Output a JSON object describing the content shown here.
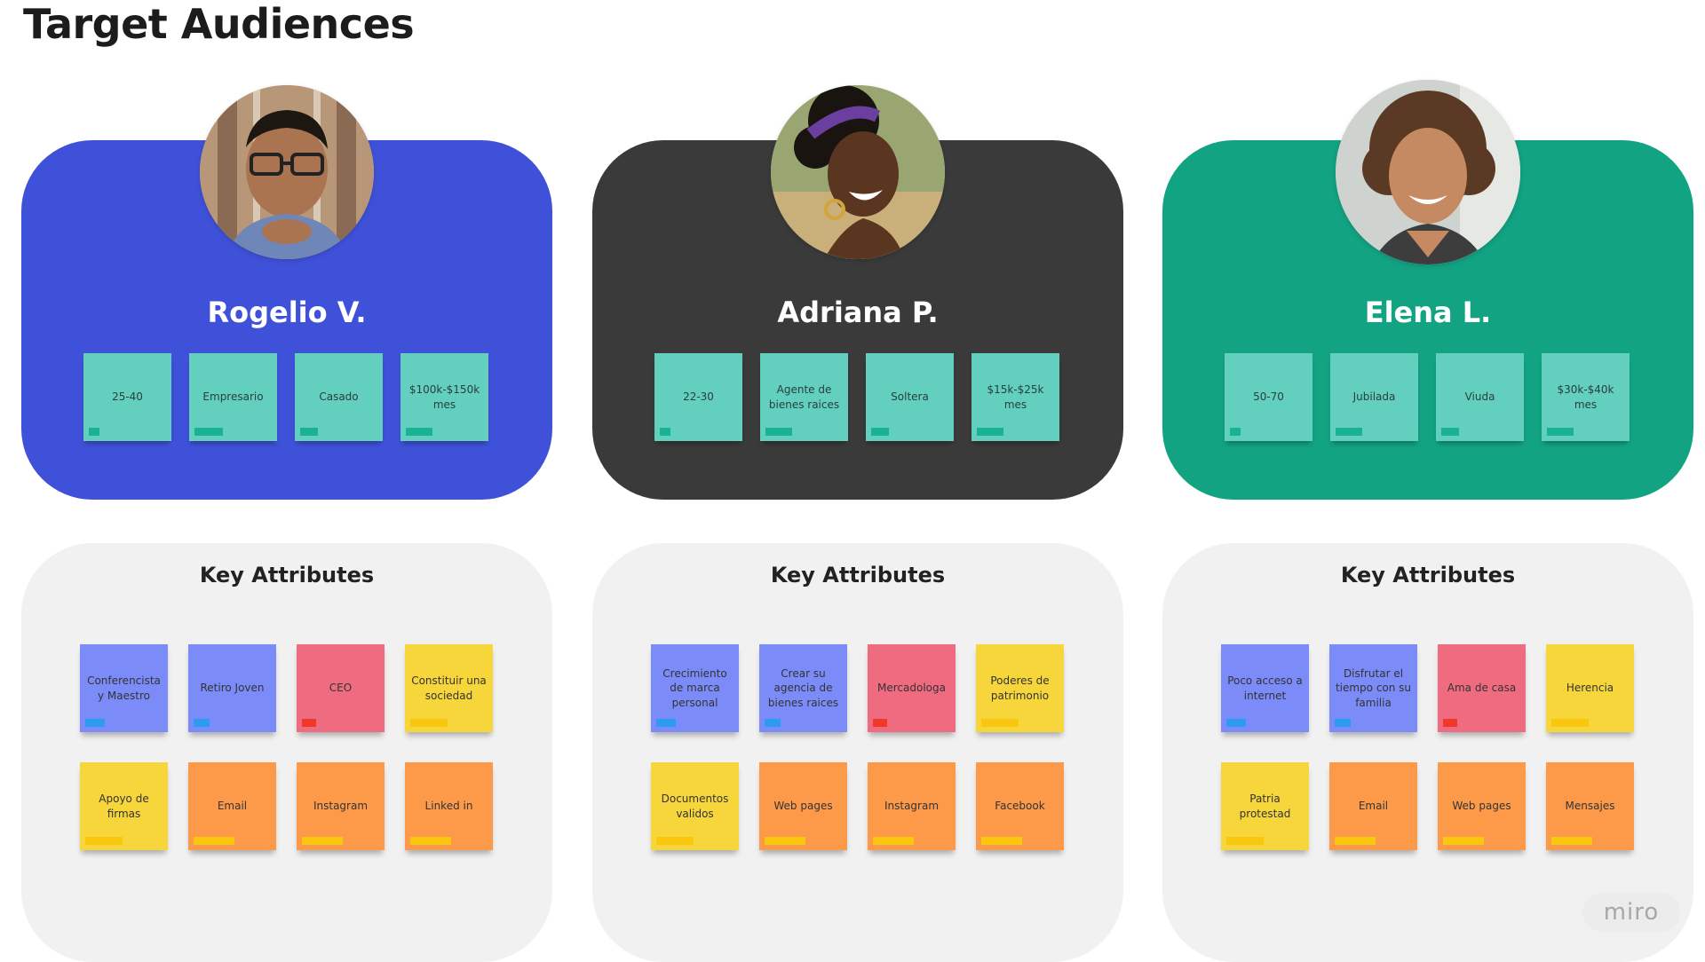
{
  "title": "Target Audiences",
  "attributes_heading": "Key Attributes",
  "personas": [
    {
      "name": "Rogelio V.",
      "card_color": "#3f51d8",
      "avatar_icon": "man-portrait",
      "demographics": [
        "25-40",
        "Empresario",
        "Casado",
        "$100k-$150k mes"
      ],
      "attributes": [
        {
          "label": "Conferencista y Maestro",
          "color": "blue"
        },
        {
          "label": "Retiro Joven",
          "color": "blue"
        },
        {
          "label": "CEO",
          "color": "red"
        },
        {
          "label": "Constituir una sociedad",
          "color": "yellow"
        },
        {
          "label": "Apoyo de firmas",
          "color": "yellow"
        },
        {
          "label": "Email",
          "color": "orange"
        },
        {
          "label": "Instagram",
          "color": "orange"
        },
        {
          "label": "Linked in",
          "color": "orange"
        }
      ]
    },
    {
      "name": "Adriana P.",
      "card_color": "#3a3a3a",
      "avatar_icon": "woman-portrait",
      "demographics": [
        "22-30",
        "Agente de bienes raices",
        "Soltera",
        "$15k-$25k mes"
      ],
      "attributes": [
        {
          "label": "Crecimiento de marca personal",
          "color": "blue"
        },
        {
          "label": "Crear su agencia de bienes raices",
          "color": "blue"
        },
        {
          "label": "Mercadologa",
          "color": "red"
        },
        {
          "label": "Poderes de patrimonio",
          "color": "yellow"
        },
        {
          "label": "Documentos validos",
          "color": "yellow"
        },
        {
          "label": "Web pages",
          "color": "orange"
        },
        {
          "label": "Instagram",
          "color": "orange"
        },
        {
          "label": "Facebook",
          "color": "orange"
        }
      ]
    },
    {
      "name": "Elena L.",
      "card_color": "#12a383",
      "avatar_icon": "woman-portrait",
      "demographics": [
        "50-70",
        "Jubilada",
        "Viuda",
        "$30k-$40k mes"
      ],
      "attributes": [
        {
          "label": "Poco acceso a internet",
          "color": "blue"
        },
        {
          "label": "Disfrutar el tiempo con su familia",
          "color": "blue"
        },
        {
          "label": "Ama de casa",
          "color": "red"
        },
        {
          "label": "Herencia",
          "color": "yellow"
        },
        {
          "label": "Patria protestad",
          "color": "yellow"
        },
        {
          "label": "Email",
          "color": "orange"
        },
        {
          "label": "Web pages",
          "color": "orange"
        },
        {
          "label": "Mensajes",
          "color": "orange"
        }
      ]
    }
  ],
  "note_colors": {
    "blue": {
      "bg": "#7b8bf8",
      "tag": "#2d9bf0"
    },
    "red": {
      "bg": "#ef6b80",
      "tag": "#f0392b"
    },
    "yellow": {
      "bg": "#f7d63c",
      "tag": "#fac710"
    },
    "orange": {
      "bg": "#fd9a4a",
      "tag": "#fac710"
    }
  },
  "brand": "miro"
}
